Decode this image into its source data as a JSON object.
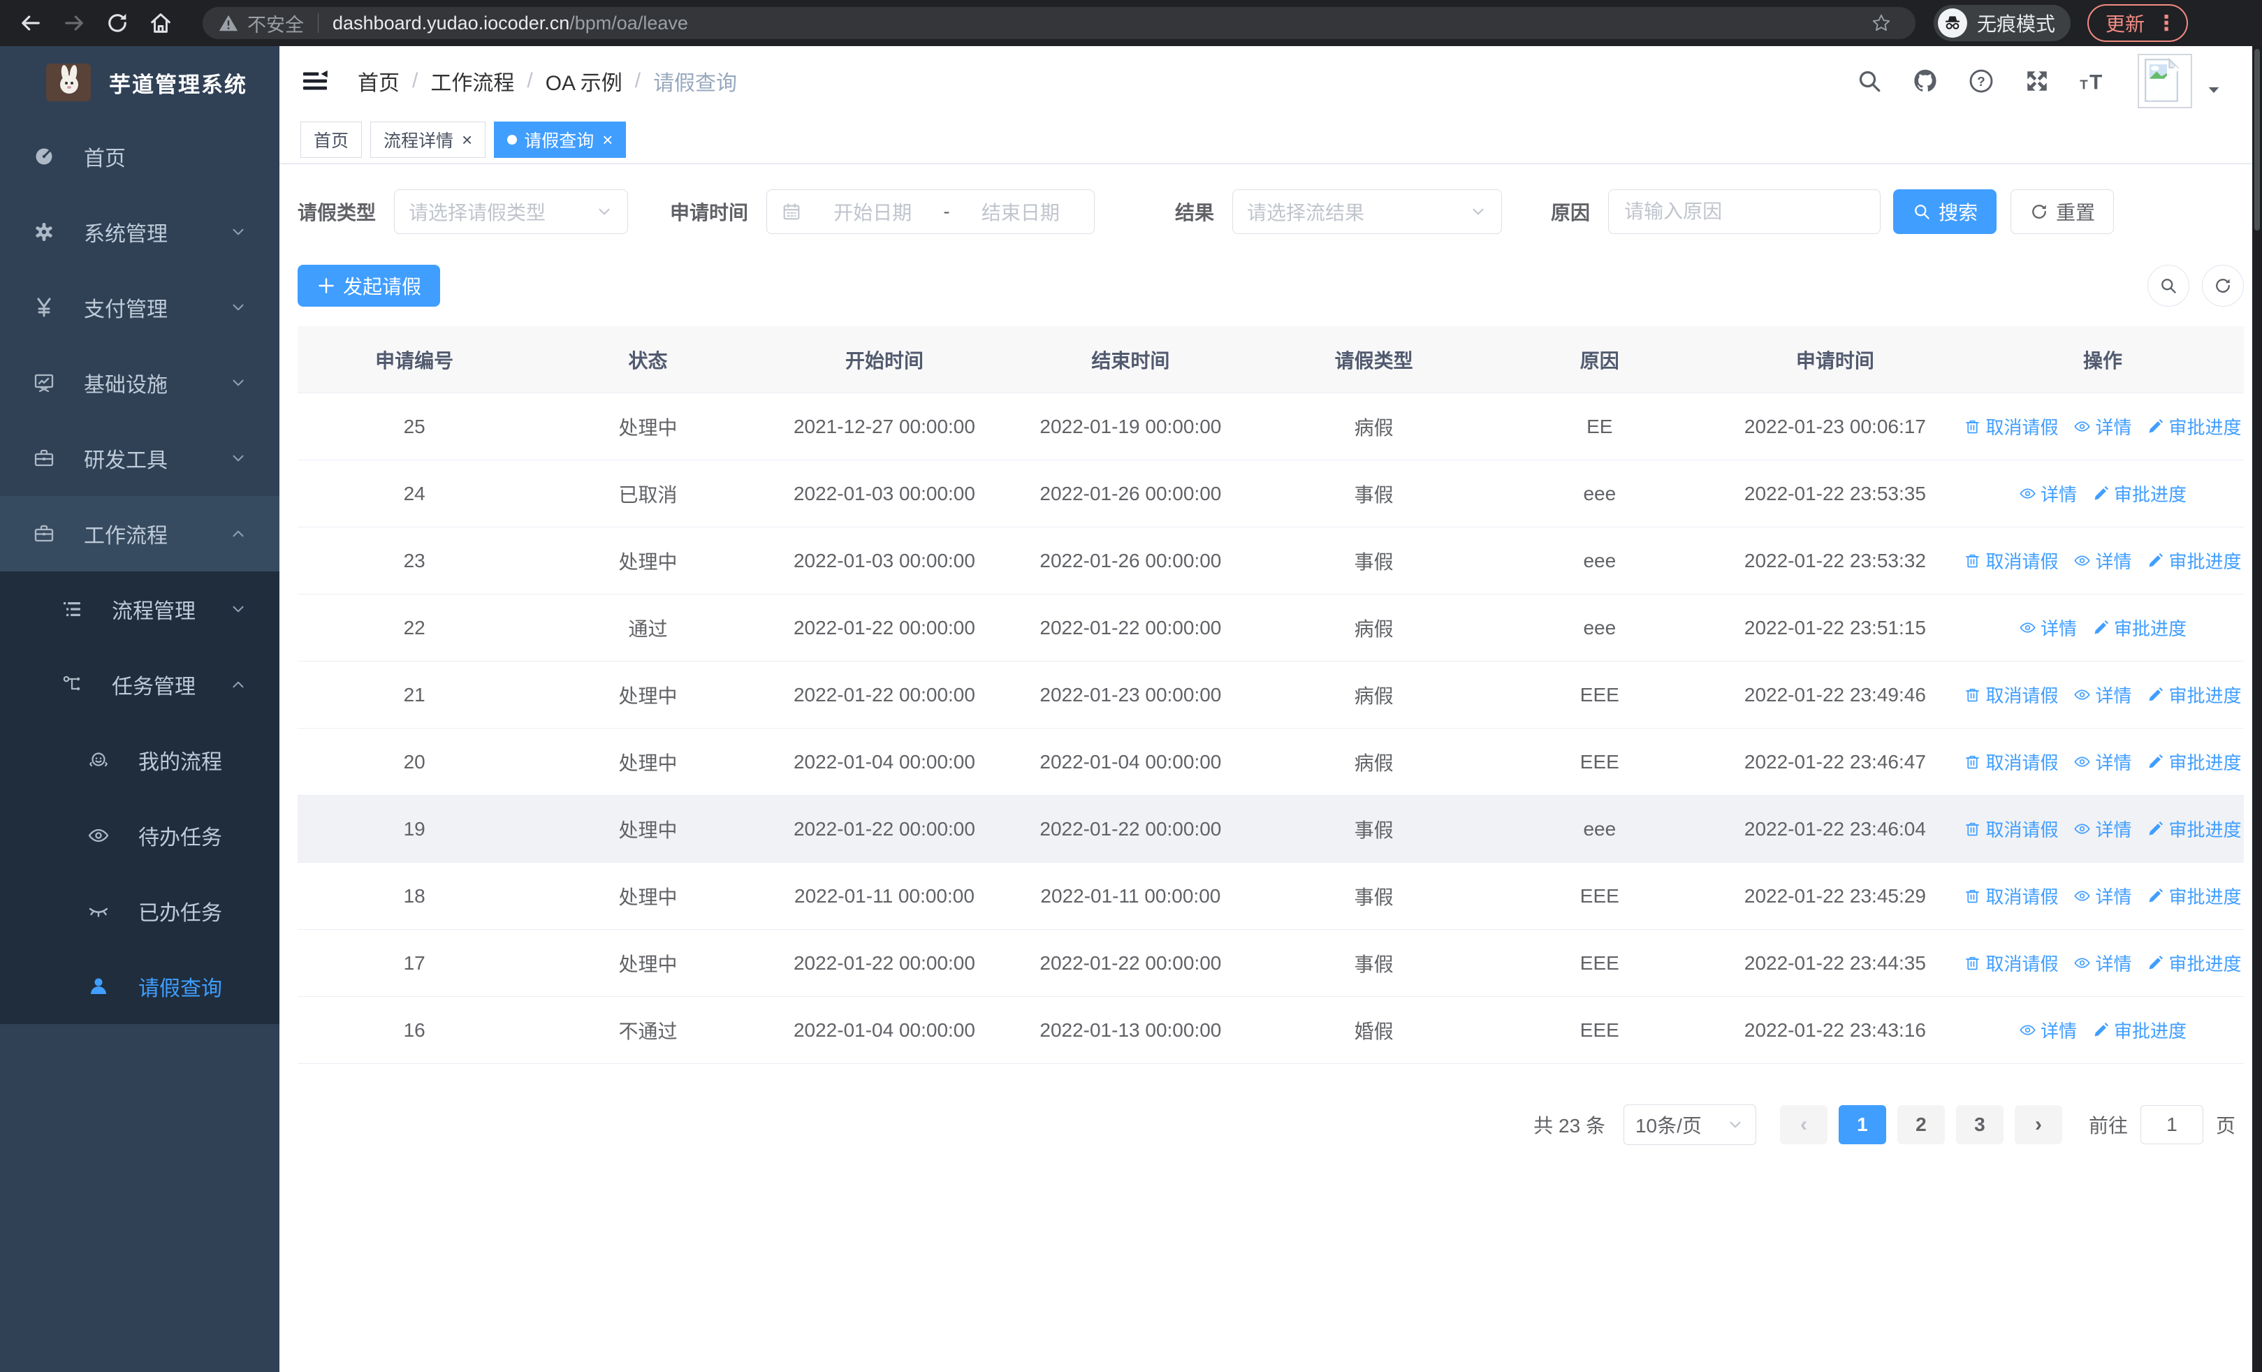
{
  "browser": {
    "security_label": "不安全",
    "url_host": "dashboard.yudao.iocoder.cn",
    "url_path": "/bpm/oa/leave",
    "incognito_label": "无痕模式",
    "update_label": "更新"
  },
  "sidebar": {
    "title": "芋道管理系统",
    "items": [
      {
        "name": "home",
        "label": "首页",
        "icon": "dashboard-icon",
        "level": 1
      },
      {
        "name": "system-management",
        "label": "系统管理",
        "icon": "gear-icon",
        "level": 1,
        "chevron": "down"
      },
      {
        "name": "payment-management",
        "label": "支付管理",
        "icon": "yen-icon",
        "level": 1,
        "chevron": "down"
      },
      {
        "name": "infrastructure",
        "label": "基础设施",
        "icon": "monitor-icon",
        "level": 1,
        "chevron": "down"
      },
      {
        "name": "dev-tools",
        "label": "研发工具",
        "icon": "toolbox-icon",
        "level": 1,
        "chevron": "down"
      },
      {
        "name": "workflow",
        "label": "工作流程",
        "icon": "briefcase-icon",
        "level": 1,
        "chevron": "up",
        "highlight": true
      },
      {
        "name": "process-management",
        "label": "流程管理",
        "icon": "list-tree-icon",
        "level": 2,
        "chevron": "down",
        "dark": true
      },
      {
        "name": "task-management",
        "label": "任务管理",
        "icon": "flow-icon",
        "level": 2,
        "chevron": "up",
        "dark": true
      },
      {
        "name": "my-process",
        "label": "我的流程",
        "icon": "face-icon",
        "level": 3,
        "dark": true
      },
      {
        "name": "todo-tasks",
        "label": "待办任务",
        "icon": "eye-open-icon",
        "level": 3,
        "dark": true
      },
      {
        "name": "done-tasks",
        "label": "已办任务",
        "icon": "eye-closed-icon",
        "level": 3,
        "dark": true
      },
      {
        "name": "leave-query",
        "label": "请假查询",
        "icon": "person-icon",
        "level": 3,
        "dark": true,
        "active": true
      }
    ]
  },
  "header": {
    "breadcrumb": [
      "首页",
      "工作流程",
      "OA 示例",
      "请假查询"
    ]
  },
  "tabs": [
    {
      "name": "home",
      "label": "首页",
      "closable": false,
      "active": false
    },
    {
      "name": "process-detail",
      "label": "流程详情",
      "closable": true,
      "active": false
    },
    {
      "name": "leave-query",
      "label": "请假查询",
      "closable": true,
      "active": true
    }
  ],
  "filters": {
    "type_label": "请假类型",
    "type_placeholder": "请选择请假类型",
    "time_label": "申请时间",
    "time_start_placeholder": "开始日期",
    "time_separator": "-",
    "time_end_placeholder": "结束日期",
    "result_label": "结果",
    "result_placeholder": "请选择流结果",
    "reason_label": "原因",
    "reason_placeholder": "请输入原因",
    "search_label": "搜索",
    "reset_label": "重置"
  },
  "toolbar": {
    "create_label": "发起请假"
  },
  "table": {
    "columns": [
      {
        "key": "id",
        "label": "申请编号"
      },
      {
        "key": "status",
        "label": "状态"
      },
      {
        "key": "start",
        "label": "开始时间"
      },
      {
        "key": "end",
        "label": "结束时间"
      },
      {
        "key": "type",
        "label": "请假类型"
      },
      {
        "key": "reason",
        "label": "原因"
      },
      {
        "key": "applied",
        "label": "申请时间"
      },
      {
        "key": "ops",
        "label": "操作"
      }
    ],
    "actions": {
      "cancel": {
        "label": "取消请假",
        "icon": "trash-icon"
      },
      "detail": {
        "label": "详情",
        "icon": "eye-icon"
      },
      "progress": {
        "label": "审批进度",
        "icon": "pen-icon"
      }
    },
    "rows": [
      {
        "id": "25",
        "status": "处理中",
        "start": "2021-12-27 00:00:00",
        "end": "2022-01-19 00:00:00",
        "type": "病假",
        "reason": "EE",
        "applied": "2022-01-23 00:06:17",
        "actions": [
          "cancel",
          "detail",
          "progress"
        ]
      },
      {
        "id": "24",
        "status": "已取消",
        "start": "2022-01-03 00:00:00",
        "end": "2022-01-26 00:00:00",
        "type": "事假",
        "reason": "eee",
        "applied": "2022-01-22 23:53:35",
        "actions": [
          "detail",
          "progress"
        ]
      },
      {
        "id": "23",
        "status": "处理中",
        "start": "2022-01-03 00:00:00",
        "end": "2022-01-26 00:00:00",
        "type": "事假",
        "reason": "eee",
        "applied": "2022-01-22 23:53:32",
        "actions": [
          "cancel",
          "detail",
          "progress"
        ]
      },
      {
        "id": "22",
        "status": "通过",
        "start": "2022-01-22 00:00:00",
        "end": "2022-01-22 00:00:00",
        "type": "病假",
        "reason": "eee",
        "applied": "2022-01-22 23:51:15",
        "actions": [
          "detail",
          "progress"
        ]
      },
      {
        "id": "21",
        "status": "处理中",
        "start": "2022-01-22 00:00:00",
        "end": "2022-01-23 00:00:00",
        "type": "病假",
        "reason": "EEE",
        "applied": "2022-01-22 23:49:46",
        "actions": [
          "cancel",
          "detail",
          "progress"
        ]
      },
      {
        "id": "20",
        "status": "处理中",
        "start": "2022-01-04 00:00:00",
        "end": "2022-01-04 00:00:00",
        "type": "病假",
        "reason": "EEE",
        "applied": "2022-01-22 23:46:47",
        "actions": [
          "cancel",
          "detail",
          "progress"
        ]
      },
      {
        "id": "19",
        "status": "处理中",
        "start": "2022-01-22 00:00:00",
        "end": "2022-01-22 00:00:00",
        "type": "事假",
        "reason": "eee",
        "applied": "2022-01-22 23:46:04",
        "actions": [
          "cancel",
          "detail",
          "progress"
        ],
        "highlight": true
      },
      {
        "id": "18",
        "status": "处理中",
        "start": "2022-01-11 00:00:00",
        "end": "2022-01-11 00:00:00",
        "type": "事假",
        "reason": "EEE",
        "applied": "2022-01-22 23:45:29",
        "actions": [
          "cancel",
          "detail",
          "progress"
        ]
      },
      {
        "id": "17",
        "status": "处理中",
        "start": "2022-01-22 00:00:00",
        "end": "2022-01-22 00:00:00",
        "type": "事假",
        "reason": "EEE",
        "applied": "2022-01-22 23:44:35",
        "actions": [
          "cancel",
          "detail",
          "progress"
        ]
      },
      {
        "id": "16",
        "status": "不通过",
        "start": "2022-01-04 00:00:00",
        "end": "2022-01-13 00:00:00",
        "type": "婚假",
        "reason": "EEE",
        "applied": "2022-01-22 23:43:16",
        "actions": [
          "detail",
          "progress"
        ]
      }
    ]
  },
  "pagination": {
    "total_label": "共 23 条",
    "page_size_label": "10条/页",
    "pages": [
      "1",
      "2",
      "3"
    ],
    "current_page": "1",
    "goto_label": "前往",
    "goto_value": "1",
    "page_unit_label": "页"
  },
  "colors": {
    "accent": "#409eff",
    "sidebar_bg": "#304156",
    "submenu_bg": "#1f2d3d",
    "update_badge": "#f28b82"
  }
}
